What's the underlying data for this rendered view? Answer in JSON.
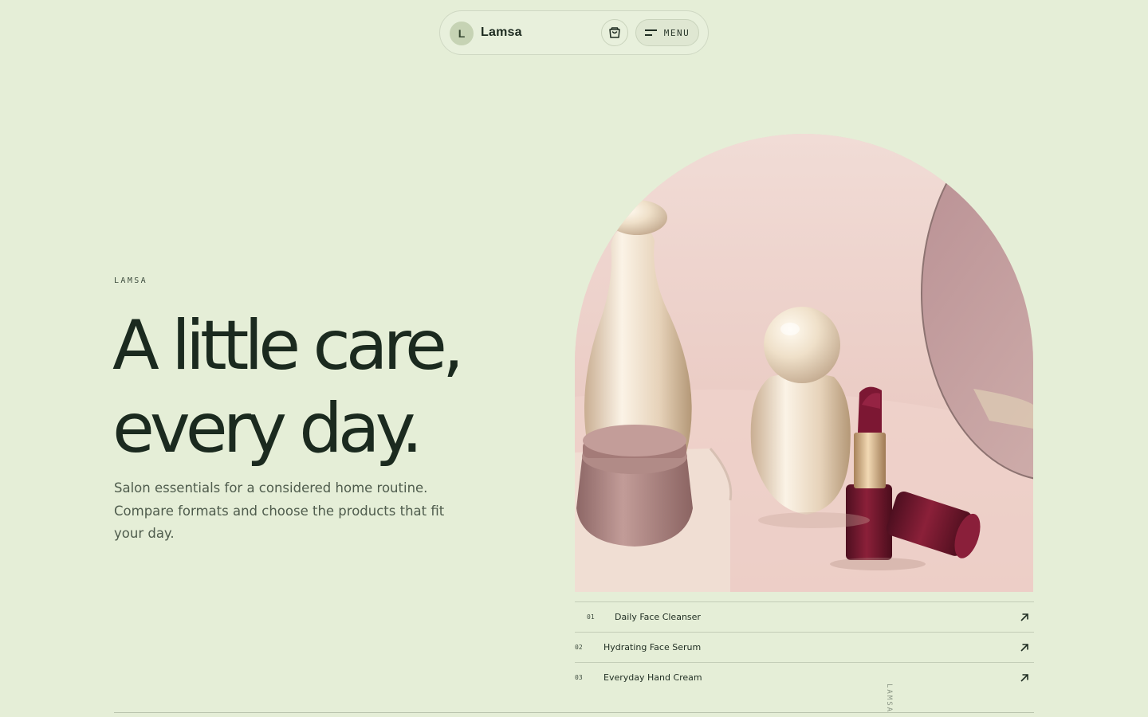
{
  "nav": {
    "logo_letter": "L",
    "brand": "Lamsa",
    "cart_icon": "shopping-bag-icon",
    "menu_icon": "menu-lines-icon",
    "menu_label": "MENU"
  },
  "hero": {
    "eyebrow": "LAMSA",
    "headline_line1": "A little care,",
    "headline_line2": "every day.",
    "lede": "Salon essentials for a considered home routine. Compare formats and choose the products that fit your day."
  },
  "products": [
    {
      "num": "01",
      "name": "Daily Face Cleanser"
    },
    {
      "num": "02",
      "name": "Hydrating Face Serum"
    },
    {
      "num": "03",
      "name": "Everyday Hand Cream"
    }
  ],
  "side_label": "LAMSA",
  "colors": {
    "background": "#e5eed7",
    "text": "#1b2a1f",
    "accent": "#c6d3b4",
    "lipstick": "#7a1730"
  }
}
